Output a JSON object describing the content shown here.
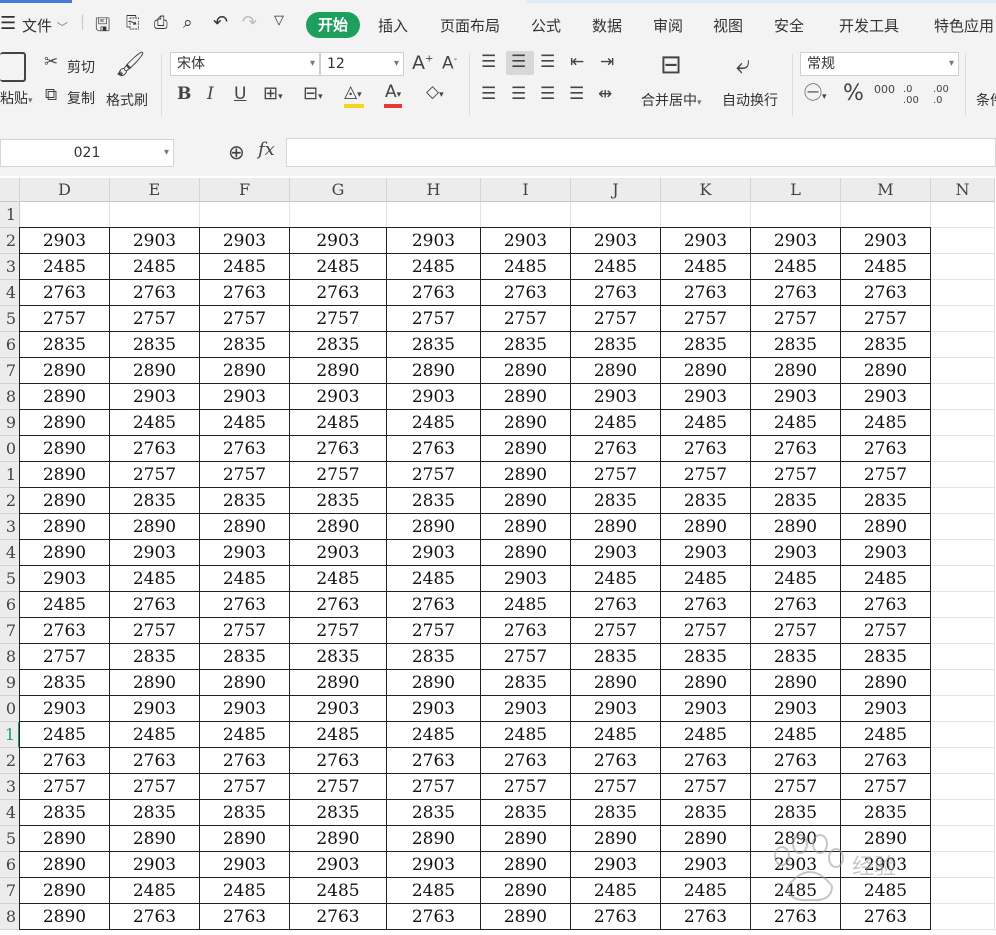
{
  "menu": {
    "file_label": "文件",
    "tabs": [
      "开始",
      "插入",
      "页面布局",
      "公式",
      "数据",
      "审阅",
      "视图",
      "安全",
      "开发工具",
      "特色应用"
    ],
    "active_tab": "开始"
  },
  "ribbon": {
    "paste_label": "粘贴",
    "cut_label": "剪切",
    "copy_label": "复制",
    "format_painter_label": "格式刷",
    "font_name": "宋体",
    "font_size": "12",
    "merge_center_label": "合并居中",
    "wrap_text_label": "自动换行",
    "number_format": "常规",
    "percent_symbol": "%",
    "thousands_label": "000",
    "increase_decimal_label": ".0 .00",
    "decrease_decimal_label": ".00 .0",
    "conditional_label": "条件"
  },
  "formula_bar": {
    "name_box": "021",
    "fx_label": "fx",
    "formula": ""
  },
  "sheet": {
    "columns": [
      "D",
      "E",
      "F",
      "G",
      "H",
      "I",
      "J",
      "K",
      "L",
      "M",
      "N"
    ],
    "row_numbers": [
      "1",
      "2",
      "3",
      "4",
      "5",
      "6",
      "7",
      "8",
      "9",
      "0",
      "1",
      "2",
      "3",
      "4",
      "5",
      "6",
      "7",
      "8",
      "9",
      "0",
      "1",
      "2",
      "3",
      "4",
      "5",
      "6",
      "7",
      "8"
    ],
    "selected_row_index": 20,
    "rows": [
      [
        "",
        "",
        "",
        "",
        "",
        "",
        "",
        "",
        "",
        ""
      ],
      [
        "2903",
        "2903",
        "2903",
        "2903",
        "2903",
        "2903",
        "2903",
        "2903",
        "2903",
        "2903"
      ],
      [
        "2485",
        "2485",
        "2485",
        "2485",
        "2485",
        "2485",
        "2485",
        "2485",
        "2485",
        "2485"
      ],
      [
        "2763",
        "2763",
        "2763",
        "2763",
        "2763",
        "2763",
        "2763",
        "2763",
        "2763",
        "2763"
      ],
      [
        "2757",
        "2757",
        "2757",
        "2757",
        "2757",
        "2757",
        "2757",
        "2757",
        "2757",
        "2757"
      ],
      [
        "2835",
        "2835",
        "2835",
        "2835",
        "2835",
        "2835",
        "2835",
        "2835",
        "2835",
        "2835"
      ],
      [
        "2890",
        "2890",
        "2890",
        "2890",
        "2890",
        "2890",
        "2890",
        "2890",
        "2890",
        "2890"
      ],
      [
        "2890",
        "2903",
        "2903",
        "2903",
        "2903",
        "2890",
        "2903",
        "2903",
        "2903",
        "2903"
      ],
      [
        "2890",
        "2485",
        "2485",
        "2485",
        "2485",
        "2890",
        "2485",
        "2485",
        "2485",
        "2485"
      ],
      [
        "2890",
        "2763",
        "2763",
        "2763",
        "2763",
        "2890",
        "2763",
        "2763",
        "2763",
        "2763"
      ],
      [
        "2890",
        "2757",
        "2757",
        "2757",
        "2757",
        "2890",
        "2757",
        "2757",
        "2757",
        "2757"
      ],
      [
        "2890",
        "2835",
        "2835",
        "2835",
        "2835",
        "2890",
        "2835",
        "2835",
        "2835",
        "2835"
      ],
      [
        "2890",
        "2890",
        "2890",
        "2890",
        "2890",
        "2890",
        "2890",
        "2890",
        "2890",
        "2890"
      ],
      [
        "2890",
        "2903",
        "2903",
        "2903",
        "2903",
        "2890",
        "2903",
        "2903",
        "2903",
        "2903"
      ],
      [
        "2903",
        "2485",
        "2485",
        "2485",
        "2485",
        "2903",
        "2485",
        "2485",
        "2485",
        "2485"
      ],
      [
        "2485",
        "2763",
        "2763",
        "2763",
        "2763",
        "2485",
        "2763",
        "2763",
        "2763",
        "2763"
      ],
      [
        "2763",
        "2757",
        "2757",
        "2757",
        "2757",
        "2763",
        "2757",
        "2757",
        "2757",
        "2757"
      ],
      [
        "2757",
        "2835",
        "2835",
        "2835",
        "2835",
        "2757",
        "2835",
        "2835",
        "2835",
        "2835"
      ],
      [
        "2835",
        "2890",
        "2890",
        "2890",
        "2890",
        "2835",
        "2890",
        "2890",
        "2890",
        "2890"
      ],
      [
        "2903",
        "2903",
        "2903",
        "2903",
        "2903",
        "2903",
        "2903",
        "2903",
        "2903",
        "2903"
      ],
      [
        "2485",
        "2485",
        "2485",
        "2485",
        "2485",
        "2485",
        "2485",
        "2485",
        "2485",
        "2485"
      ],
      [
        "2763",
        "2763",
        "2763",
        "2763",
        "2763",
        "2763",
        "2763",
        "2763",
        "2763",
        "2763"
      ],
      [
        "2757",
        "2757",
        "2757",
        "2757",
        "2757",
        "2757",
        "2757",
        "2757",
        "2757",
        "2757"
      ],
      [
        "2835",
        "2835",
        "2835",
        "2835",
        "2835",
        "2835",
        "2835",
        "2835",
        "2835",
        "2835"
      ],
      [
        "2890",
        "2890",
        "2890",
        "2890",
        "2890",
        "2890",
        "2890",
        "2890",
        "2890",
        "2890"
      ],
      [
        "2890",
        "2903",
        "2903",
        "2903",
        "2903",
        "2890",
        "2903",
        "2903",
        "2903",
        "2903"
      ],
      [
        "2890",
        "2485",
        "2485",
        "2485",
        "2485",
        "2890",
        "2485",
        "2485",
        "2485",
        "2485"
      ],
      [
        "2890",
        "2763",
        "2763",
        "2763",
        "2763",
        "2890",
        "2763",
        "2763",
        "2763",
        "2763"
      ]
    ]
  },
  "colors": {
    "accent": "#1e9f5d",
    "font_color_bar": "#e53935",
    "fill_color_bar": "#f7d51d"
  }
}
